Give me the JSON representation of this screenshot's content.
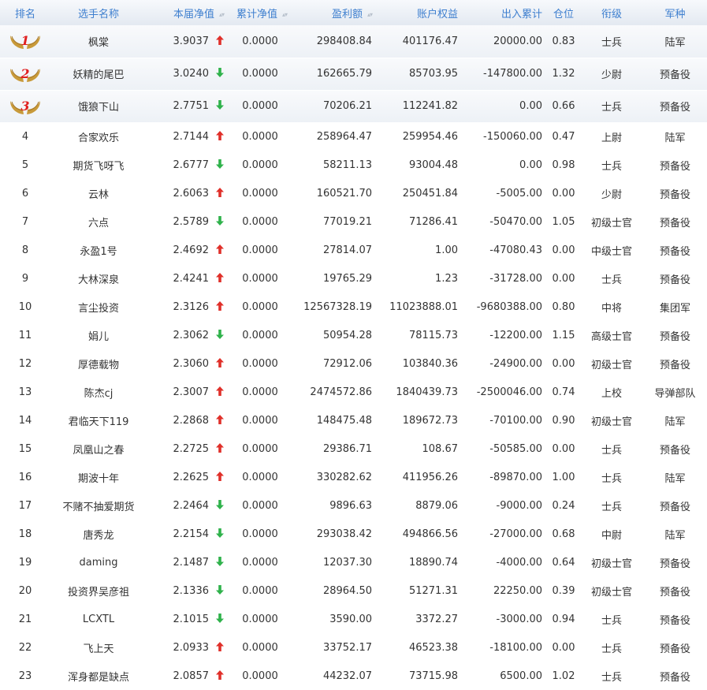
{
  "colors": {
    "header_text": "#3e7fcf",
    "up": "#e0302a",
    "down": "#2fb24b",
    "medal_gold": "#c89a3a",
    "medal_rank": "#e02020"
  },
  "columns": [
    "排名",
    "选手名称",
    "本届净值",
    "累计净值",
    "盈利额",
    "账户权益",
    "出入累计",
    "仓位",
    "衔级",
    "军种"
  ],
  "rows": [
    {
      "rank": "1",
      "name": "枫棠",
      "nav": "3.9037",
      "trend": "up",
      "cum": "0.0000",
      "profit": "298408.84",
      "equity": "401176.47",
      "flow": "20000.00",
      "pos": "0.83",
      "title": "士兵",
      "branch": "陆军"
    },
    {
      "rank": "2",
      "name": "妖精的尾巴",
      "nav": "3.0240",
      "trend": "down",
      "cum": "0.0000",
      "profit": "162665.79",
      "equity": "85703.95",
      "flow": "-147800.00",
      "pos": "1.32",
      "title": "少尉",
      "branch": "预备役"
    },
    {
      "rank": "3",
      "name": "饿狼下山",
      "nav": "2.7751",
      "trend": "down",
      "cum": "0.0000",
      "profit": "70206.21",
      "equity": "112241.82",
      "flow": "0.00",
      "pos": "0.66",
      "title": "士兵",
      "branch": "预备役"
    },
    {
      "rank": "4",
      "name": "合家欢乐",
      "nav": "2.7144",
      "trend": "up",
      "cum": "0.0000",
      "profit": "258964.47",
      "equity": "259954.46",
      "flow": "-150060.00",
      "pos": "0.47",
      "title": "上尉",
      "branch": "陆军"
    },
    {
      "rank": "5",
      "name": "期货飞呀飞",
      "nav": "2.6777",
      "trend": "down",
      "cum": "0.0000",
      "profit": "58211.13",
      "equity": "93004.48",
      "flow": "0.00",
      "pos": "0.98",
      "title": "士兵",
      "branch": "预备役"
    },
    {
      "rank": "6",
      "name": "云林",
      "nav": "2.6063",
      "trend": "up",
      "cum": "0.0000",
      "profit": "160521.70",
      "equity": "250451.84",
      "flow": "-5005.00",
      "pos": "0.00",
      "title": "少尉",
      "branch": "预备役"
    },
    {
      "rank": "7",
      "name": "六点",
      "nav": "2.5789",
      "trend": "down",
      "cum": "0.0000",
      "profit": "77019.21",
      "equity": "71286.41",
      "flow": "-50470.00",
      "pos": "1.05",
      "title": "初级士官",
      "branch": "预备役"
    },
    {
      "rank": "8",
      "name": "永盈1号",
      "nav": "2.4692",
      "trend": "up",
      "cum": "0.0000",
      "profit": "27814.07",
      "equity": "1.00",
      "flow": "-47080.43",
      "pos": "0.00",
      "title": "中级士官",
      "branch": "预备役"
    },
    {
      "rank": "9",
      "name": "大林深泉",
      "nav": "2.4241",
      "trend": "up",
      "cum": "0.0000",
      "profit": "19765.29",
      "equity": "1.23",
      "flow": "-31728.00",
      "pos": "0.00",
      "title": "士兵",
      "branch": "预备役"
    },
    {
      "rank": "10",
      "name": "言尘投资",
      "nav": "2.3126",
      "trend": "up",
      "cum": "0.0000",
      "profit": "12567328.19",
      "equity": "11023888.01",
      "flow": "-9680388.00",
      "pos": "0.80",
      "title": "中将",
      "branch": "集团军"
    },
    {
      "rank": "11",
      "name": "娟儿",
      "nav": "2.3062",
      "trend": "down",
      "cum": "0.0000",
      "profit": "50954.28",
      "equity": "78115.73",
      "flow": "-12200.00",
      "pos": "1.15",
      "title": "高级士官",
      "branch": "预备役"
    },
    {
      "rank": "12",
      "name": "厚德载物",
      "nav": "2.3060",
      "trend": "up",
      "cum": "0.0000",
      "profit": "72912.06",
      "equity": "103840.36",
      "flow": "-24900.00",
      "pos": "0.00",
      "title": "初级士官",
      "branch": "预备役"
    },
    {
      "rank": "13",
      "name": "陈杰cj",
      "nav": "2.3007",
      "trend": "up",
      "cum": "0.0000",
      "profit": "2474572.86",
      "equity": "1840439.73",
      "flow": "-2500046.00",
      "pos": "0.74",
      "title": "上校",
      "branch": "导弹部队"
    },
    {
      "rank": "14",
      "name": "君临天下119",
      "nav": "2.2868",
      "trend": "up",
      "cum": "0.0000",
      "profit": "148475.48",
      "equity": "189672.73",
      "flow": "-70100.00",
      "pos": "0.90",
      "title": "初级士官",
      "branch": "陆军"
    },
    {
      "rank": "15",
      "name": "凤凰山之春",
      "nav": "2.2725",
      "trend": "up",
      "cum": "0.0000",
      "profit": "29386.71",
      "equity": "108.67",
      "flow": "-50585.00",
      "pos": "0.00",
      "title": "士兵",
      "branch": "预备役"
    },
    {
      "rank": "16",
      "name": "期波十年",
      "nav": "2.2625",
      "trend": "up",
      "cum": "0.0000",
      "profit": "330282.62",
      "equity": "411956.26",
      "flow": "-89870.00",
      "pos": "1.00",
      "title": "士兵",
      "branch": "陆军"
    },
    {
      "rank": "17",
      "name": "不赌不抽爱期货",
      "nav": "2.2464",
      "trend": "down",
      "cum": "0.0000",
      "profit": "9896.63",
      "equity": "8879.06",
      "flow": "-9000.00",
      "pos": "0.24",
      "title": "士兵",
      "branch": "预备役"
    },
    {
      "rank": "18",
      "name": "唐秀龙",
      "nav": "2.2154",
      "trend": "down",
      "cum": "0.0000",
      "profit": "293038.42",
      "equity": "494866.56",
      "flow": "-27000.00",
      "pos": "0.68",
      "title": "中尉",
      "branch": "陆军"
    },
    {
      "rank": "19",
      "name": "daming",
      "nav": "2.1487",
      "trend": "down",
      "cum": "0.0000",
      "profit": "12037.30",
      "equity": "18890.74",
      "flow": "-4000.00",
      "pos": "0.64",
      "title": "初级士官",
      "branch": "预备役"
    },
    {
      "rank": "20",
      "name": "投资界吴彦祖",
      "nav": "2.1336",
      "trend": "down",
      "cum": "0.0000",
      "profit": "28964.50",
      "equity": "51271.31",
      "flow": "22250.00",
      "pos": "0.39",
      "title": "初级士官",
      "branch": "预备役"
    },
    {
      "rank": "21",
      "name": "LCXTL",
      "nav": "2.1015",
      "trend": "down",
      "cum": "0.0000",
      "profit": "3590.00",
      "equity": "3372.27",
      "flow": "-3000.00",
      "pos": "0.94",
      "title": "士兵",
      "branch": "预备役"
    },
    {
      "rank": "22",
      "name": "飞上天",
      "nav": "2.0933",
      "trend": "up",
      "cum": "0.0000",
      "profit": "33752.17",
      "equity": "46523.38",
      "flow": "-18100.00",
      "pos": "0.00",
      "title": "士兵",
      "branch": "预备役"
    },
    {
      "rank": "23",
      "name": "浑身都是缺点",
      "nav": "2.0857",
      "trend": "up",
      "cum": "0.0000",
      "profit": "44232.07",
      "equity": "73715.98",
      "flow": "6500.00",
      "pos": "1.02",
      "title": "士兵",
      "branch": "预备役"
    }
  ]
}
